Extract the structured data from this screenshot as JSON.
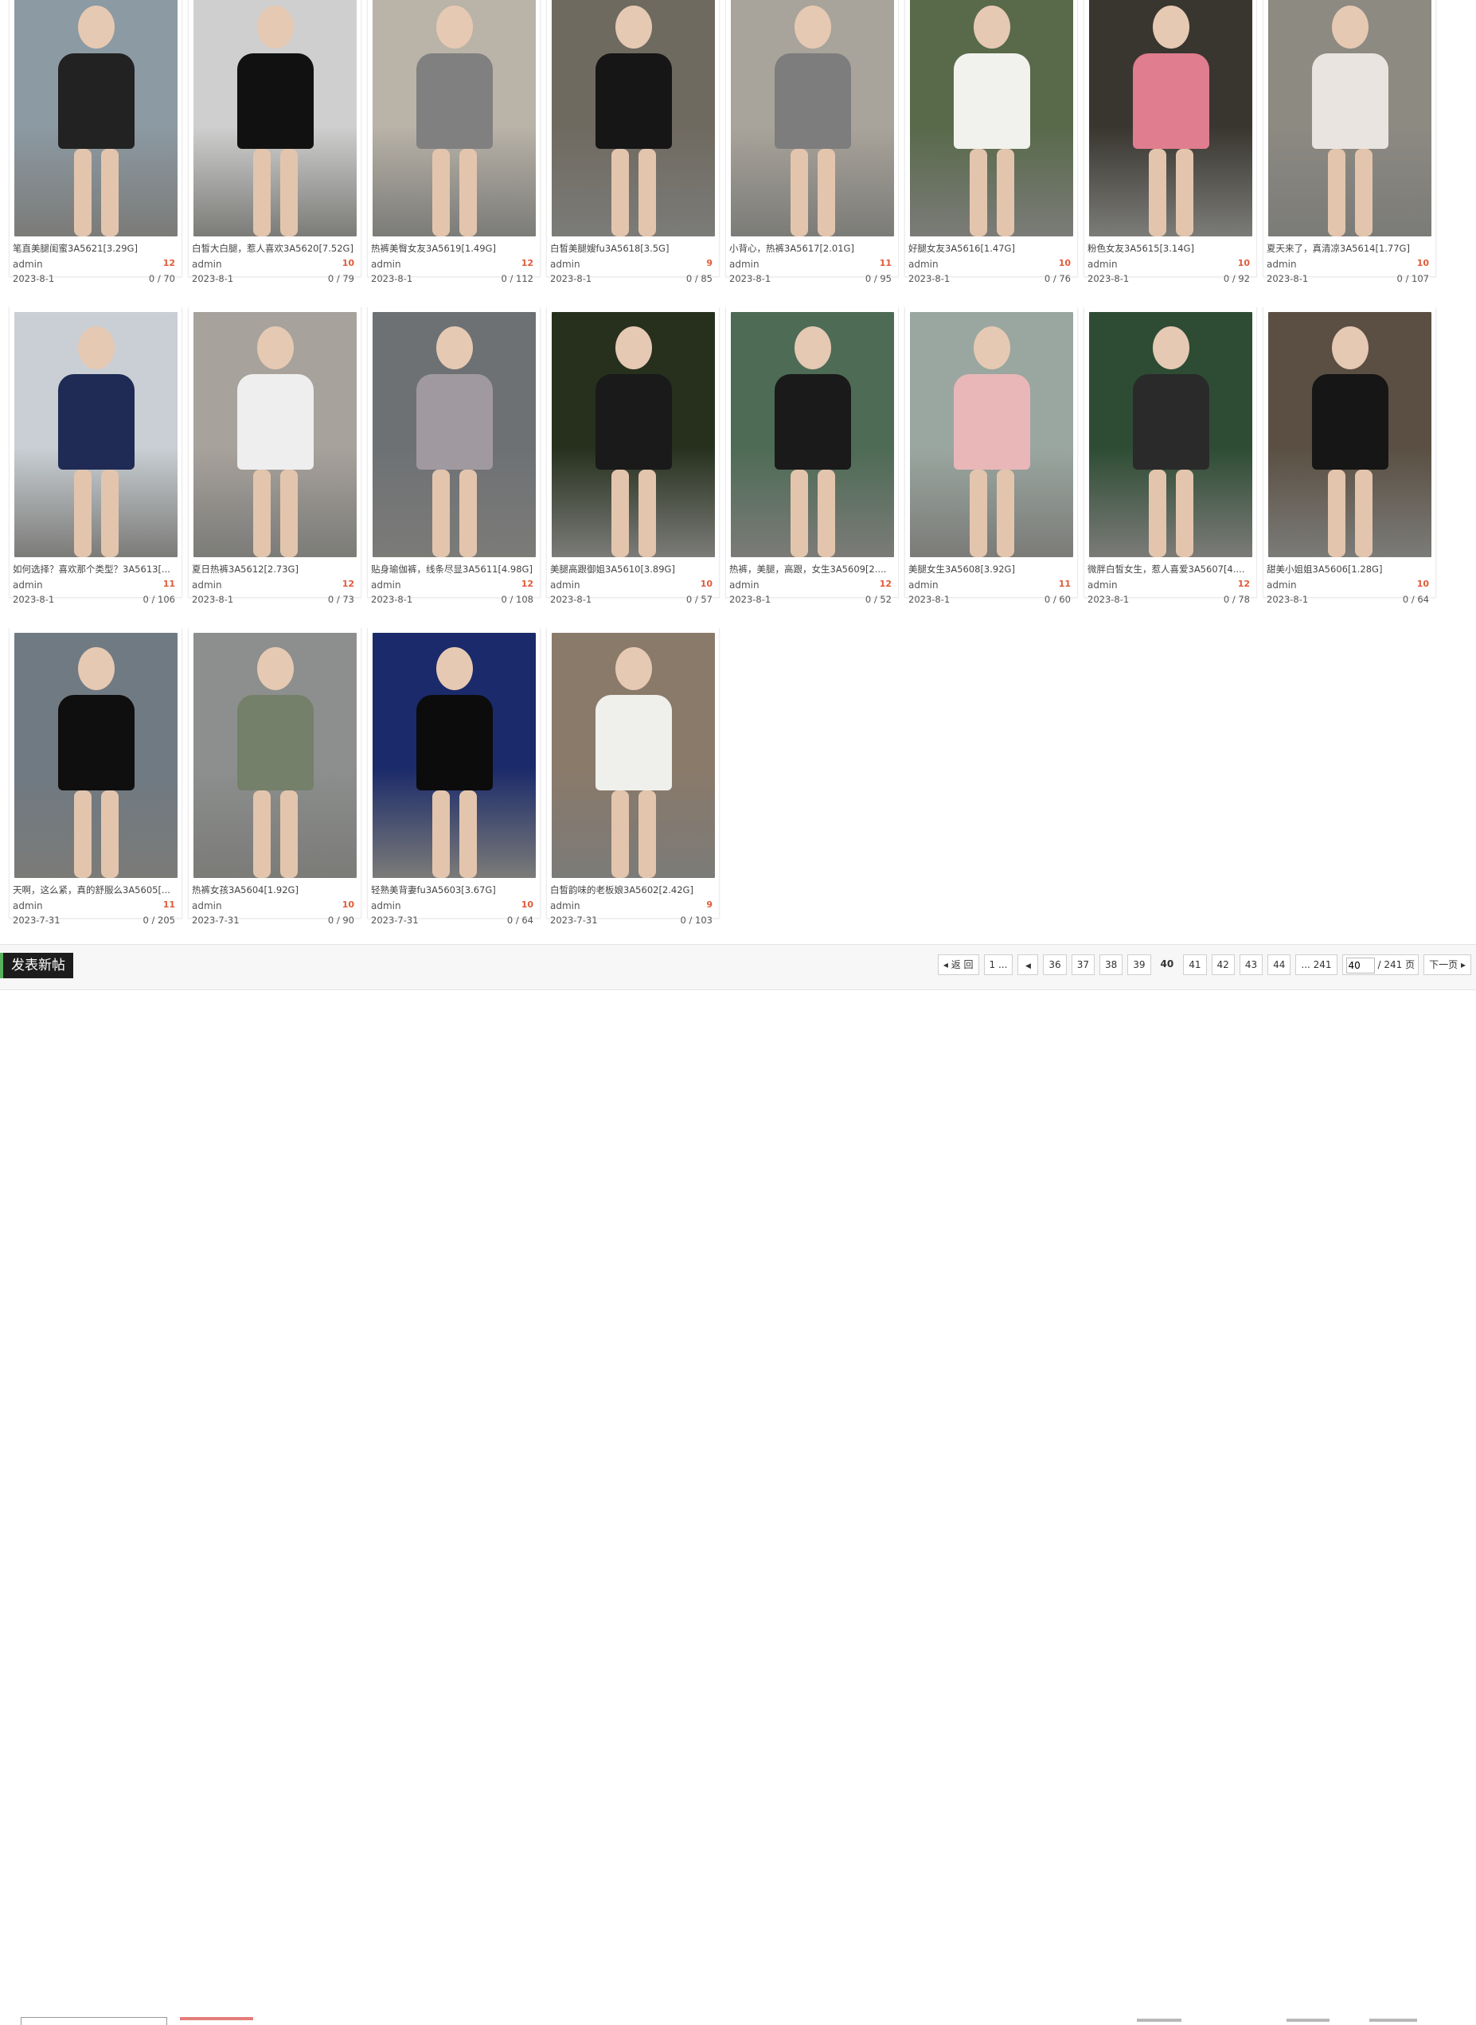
{
  "cards": [
    {
      "title": "笔直美腿闺蜜3A5621[3.29G]",
      "author": "admin",
      "likes": "12",
      "date": "2023-8-1",
      "stats": "0 / 70"
    },
    {
      "title": "白皙大白腿，惹人喜欢3A5620[7.52G]",
      "author": "admin",
      "likes": "10",
      "date": "2023-8-1",
      "stats": "0 / 79"
    },
    {
      "title": "热裤美臀女友3A5619[1.49G]",
      "author": "admin",
      "likes": "12",
      "date": "2023-8-1",
      "stats": "0 / 112"
    },
    {
      "title": "白皙美腿嫂fu3A5618[3.5G]",
      "author": "admin",
      "likes": "9",
      "date": "2023-8-1",
      "stats": "0 / 85"
    },
    {
      "title": "小背心，热裤3A5617[2.01G]",
      "author": "admin",
      "likes": "11",
      "date": "2023-8-1",
      "stats": "0 / 95"
    },
    {
      "title": "好腿女友3A5616[1.47G]",
      "author": "admin",
      "likes": "10",
      "date": "2023-8-1",
      "stats": "0 / 76"
    },
    {
      "title": "粉色女友3A5615[3.14G]",
      "author": "admin",
      "likes": "10",
      "date": "2023-8-1",
      "stats": "0 / 92"
    },
    {
      "title": "夏天来了，真清凉3A5614[1.77G]",
      "author": "admin",
      "likes": "10",
      "date": "2023-8-1",
      "stats": "0 / 107"
    },
    {
      "title": "如何选择？喜欢那个类型？3A5613[...",
      "author": "admin",
      "likes": "11",
      "date": "2023-8-1",
      "stats": "0 / 106"
    },
    {
      "title": "夏日热裤3A5612[2.73G]",
      "author": "admin",
      "likes": "12",
      "date": "2023-8-1",
      "stats": "0 / 73"
    },
    {
      "title": "贴身瑜伽裤，线条尽显3A5611[4.98G]",
      "author": "admin",
      "likes": "12",
      "date": "2023-8-1",
      "stats": "0 / 108"
    },
    {
      "title": "美腿高跟御姐3A5610[3.89G]",
      "author": "admin",
      "likes": "10",
      "date": "2023-8-1",
      "stats": "0 / 57"
    },
    {
      "title": "热裤，美腿，高跟，女生3A5609[2....",
      "author": "admin",
      "likes": "12",
      "date": "2023-8-1",
      "stats": "0 / 52"
    },
    {
      "title": "美腿女生3A5608[3.92G]",
      "author": "admin",
      "likes": "11",
      "date": "2023-8-1",
      "stats": "0 / 60"
    },
    {
      "title": "微胖白皙女生，惹人喜爱3A5607[4....",
      "author": "admin",
      "likes": "12",
      "date": "2023-8-1",
      "stats": "0 / 78"
    },
    {
      "title": "甜美小姐姐3A5606[1.28G]",
      "author": "admin",
      "likes": "10",
      "date": "2023-8-1",
      "stats": "0 / 64"
    },
    {
      "title": "天啊，这么紧，真的舒服么3A5605[...",
      "author": "admin",
      "likes": "11",
      "date": "2023-7-31",
      "stats": "0 / 205"
    },
    {
      "title": "热裤女孩3A5604[1.92G]",
      "author": "admin",
      "likes": "10",
      "date": "2023-7-31",
      "stats": "0 / 90"
    },
    {
      "title": "轻熟美背妻fu3A5603[3.67G]",
      "author": "admin",
      "likes": "10",
      "date": "2023-7-31",
      "stats": "0 / 64"
    },
    {
      "title": "白皙韵味的老板娘3A5602[2.42G]",
      "author": "admin",
      "likes": "9",
      "date": "2023-7-31",
      "stats": "0 / 103"
    }
  ],
  "toolbar": {
    "new_post_label": "发表新帖"
  },
  "pagination": {
    "back_label": "返 回",
    "first_label": "1 ...",
    "prev_symbol": "◀",
    "pages": [
      "36",
      "37",
      "38",
      "39",
      "40",
      "41",
      "42",
      "43",
      "44"
    ],
    "current": "40",
    "last_label": "... 241",
    "input_value": "40",
    "total_label": "/ 241 页",
    "next_label": "下一页"
  },
  "thumb_colors": [
    [
      "#8c9aa3",
      "#222"
    ],
    [
      "#cfcfcf",
      "#111"
    ],
    [
      "#b9b3a8",
      "#808080"
    ],
    [
      "#6f6a60",
      "#161616"
    ],
    [
      "#a9a49b",
      "#7d7d7d"
    ],
    [
      "#586a4a",
      "#f1f1ee"
    ],
    [
      "#39362f",
      "#e07d8e"
    ],
    [
      "#8d8a82",
      "#e9e4e0"
    ],
    [
      "#c9cfd4",
      "#1f2b55"
    ],
    [
      "#a8a29c",
      "#eeeeee"
    ],
    [
      "#6e7174",
      "#a09aa0"
    ],
    [
      "#26301d",
      "#1a1a1a"
    ],
    [
      "#4d6b55",
      "#1a1a1a"
    ],
    [
      "#9aa7a0",
      "#eab7b8"
    ],
    [
      "#2d4c33",
      "#2a2a2a"
    ],
    [
      "#5a4f42",
      "#161616"
    ],
    [
      "#6f7a83",
      "#0f0f0f"
    ],
    [
      "#8c8f8e",
      "#74806a"
    ],
    [
      "#1a2a6a",
      "#0c0c0c"
    ],
    [
      "#8a7a6a",
      "#efefec"
    ]
  ]
}
